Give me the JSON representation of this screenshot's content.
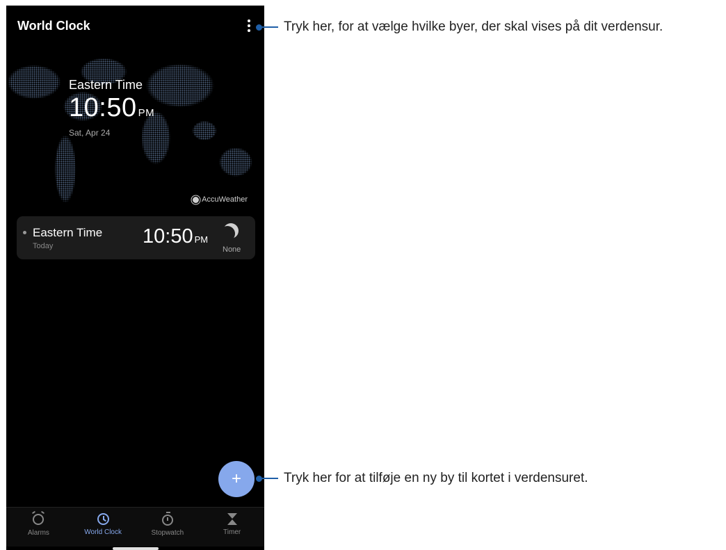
{
  "app": {
    "title": "World Clock"
  },
  "hero": {
    "zone": "Eastern Time",
    "time": "10:50",
    "ampm": "PM",
    "date": "Sat, Apr 24"
  },
  "provider": {
    "label": "AccuWeather"
  },
  "cards": [
    {
      "zone": "Eastern Time",
      "day": "Today",
      "time": "10:50",
      "ampm": "PM",
      "weather": "None",
      "icon": "moon-icon"
    }
  ],
  "fab": {
    "glyph": "+"
  },
  "nav": [
    {
      "label": "Alarms",
      "icon": "alarm-icon",
      "active": false
    },
    {
      "label": "World Clock",
      "icon": "clock-icon",
      "active": true
    },
    {
      "label": "Stopwatch",
      "icon": "stopwatch-icon",
      "active": false
    },
    {
      "label": "Timer",
      "icon": "hourglass-icon",
      "active": false
    }
  ],
  "callouts": {
    "menu": "Tryk her, for at vælge hvilke byer, der skal vises på dit verdensur.",
    "add": "Tryk her for at tilføje en ny by til kortet i verdensuret."
  },
  "colors": {
    "accent": "#86a8ec",
    "callout": "#1f5fa8",
    "background": "#000000"
  }
}
